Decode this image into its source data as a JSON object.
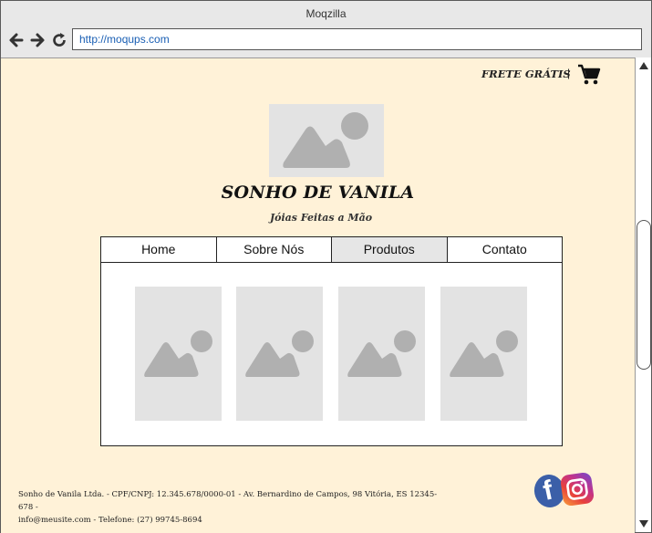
{
  "window": {
    "title": "Moqzilla"
  },
  "browser": {
    "url": "http://moqups.com",
    "back_icon": "arrow-left-icon",
    "forward_icon": "arrow-right-icon",
    "reload_icon": "reload-icon"
  },
  "header": {
    "shipping_text": "FRETE GRÁTIS",
    "separator": "|",
    "cart_icon": "shopping-cart-icon"
  },
  "brand": {
    "name": "SONHO DE VANILA",
    "tagline": "Jóias Feitas a Mão",
    "logo_icon": "image-placeholder-icon"
  },
  "nav": {
    "tabs": [
      {
        "label": "Home",
        "active": false
      },
      {
        "label": "Sobre Nós",
        "active": false
      },
      {
        "label": "Produtos",
        "active": true
      },
      {
        "label": "Contato",
        "active": false
      }
    ]
  },
  "products": [
    {
      "icon": "image-placeholder-icon"
    },
    {
      "icon": "image-placeholder-icon"
    },
    {
      "icon": "image-placeholder-icon"
    },
    {
      "icon": "image-placeholder-icon"
    }
  ],
  "footer": {
    "line1": "Sonho de Vanila Ltda. - CPF/CNPJ: 12.345.678/0000-01 - Av. Bernardino de Campos, 98 Vitória, ES 12345-678 -",
    "line2": "info@meusite.com -  Telefone: (27) 99745-8694",
    "social": {
      "facebook_icon": "facebook-icon",
      "instagram_icon": "instagram-icon"
    }
  },
  "colors": {
    "page_background": "#fff2d8",
    "placeholder": "#e3e3e3",
    "placeholder_shape": "#b0b0b0",
    "active_tab": "#e6e6e6",
    "link": "#1a5fb4"
  }
}
